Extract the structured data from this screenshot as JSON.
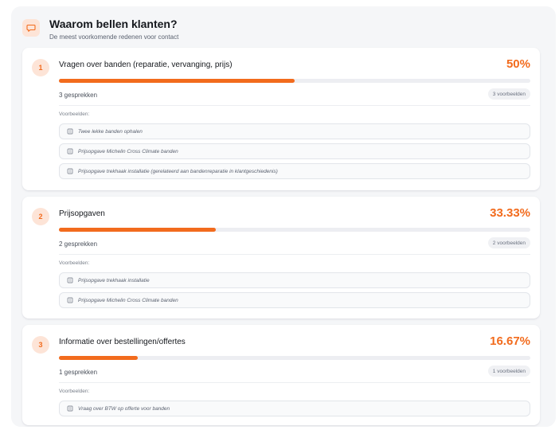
{
  "header": {
    "title": "Waarom bellen klanten?",
    "subtitle": "De meest voorkomende redenen voor contact",
    "icon": "chat-bubble-icon"
  },
  "colors": {
    "accent": "#f26b1d",
    "accent_soft": "#fde4d7",
    "track": "#edeef2"
  },
  "reasons": [
    {
      "rank": "1",
      "title": "Vragen over banden (reparatie, vervanging, prijs)",
      "percent_label": "50%",
      "share": 0.5,
      "count": "3 gesprekken",
      "examples_badge": "3 voorbeelden",
      "examples_label": "Voorbeelden:",
      "examples": [
        "Twee lekke banden ophalen",
        "Prijsopgave Michelin Cross Climate banden",
        "Prijsopgave trekhaak installatie (gerelateerd aan bandenreparatie in klantgeschiedenis)"
      ]
    },
    {
      "rank": "2",
      "title": "Prijsopgaven",
      "percent_label": "33.33%",
      "share": 0.3333,
      "count": "2 gesprekken",
      "examples_badge": "2 voorbeelden",
      "examples_label": "Voorbeelden:",
      "examples": [
        "Prijsopgave trekhaak installatie",
        "Prijsopgave Michelin Cross Climate banden"
      ]
    },
    {
      "rank": "3",
      "title": "Informatie over bestellingen/offertes",
      "percent_label": "16.67%",
      "share": 0.1667,
      "count": "1 gesprekken",
      "examples_badge": "1 voorbeelden",
      "examples_label": "Voorbeelden:",
      "examples": [
        "Vraag over BTW op offerte voor banden"
      ]
    }
  ]
}
